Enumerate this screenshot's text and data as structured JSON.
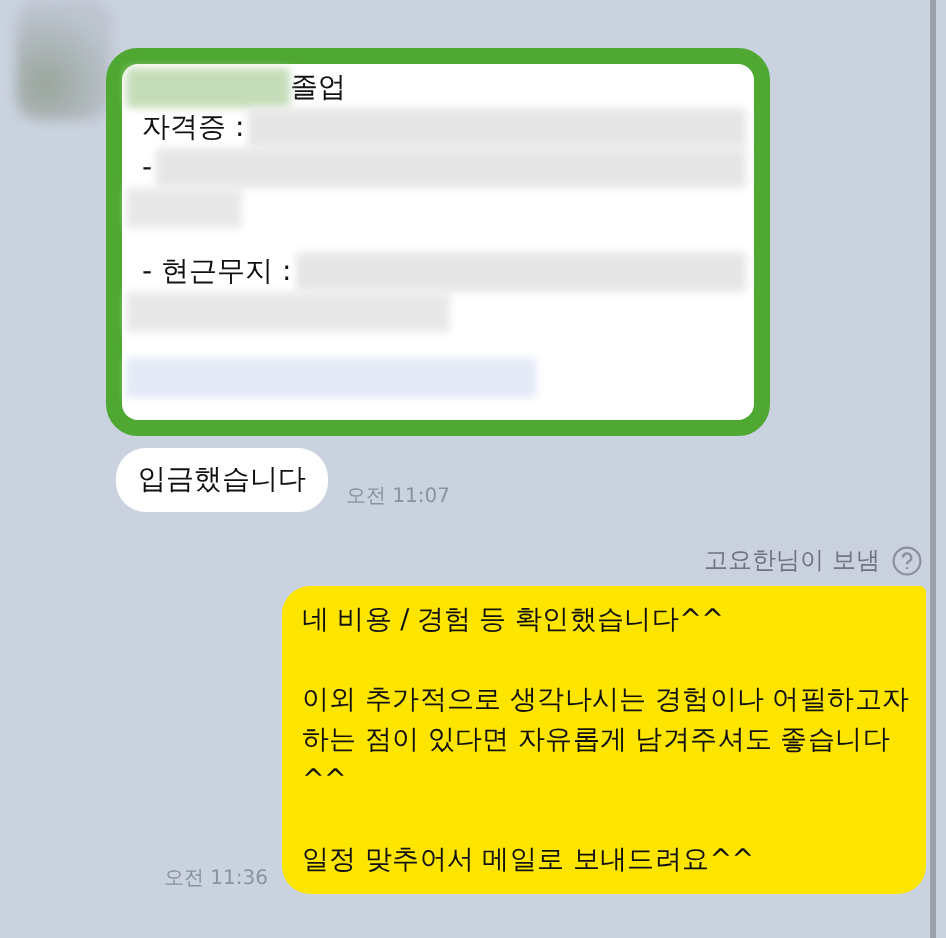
{
  "received": {
    "card_lines": [
      {
        "kind": "blurred-prefix",
        "text": "졸업"
      },
      {
        "kind": "blurred-suffix",
        "text": "자격증 :"
      },
      {
        "kind": "blurred-suffix",
        "text": "-"
      },
      {
        "kind": "blur"
      },
      {
        "kind": "gap"
      },
      {
        "kind": "blurred-suffix",
        "text": "- 현근무지 :"
      },
      {
        "kind": "blur"
      },
      {
        "kind": "gap"
      },
      {
        "kind": "link-blur"
      }
    ],
    "message": "입금했습니다",
    "time": "오전 11:07"
  },
  "sent": {
    "sender_note": "고요한님이 보냄",
    "paragraphs": [
      "네 비용 / 경험 등 확인했습니다^^",
      "이외 추가적으로 생각나시는 경험이나 어필하고자 하는 점이 있다면 자유롭게 남겨주셔도 좋습니다^^",
      "일정 맞추어서 메일로 보내드려요^^"
    ],
    "time": "오전 11:36"
  }
}
